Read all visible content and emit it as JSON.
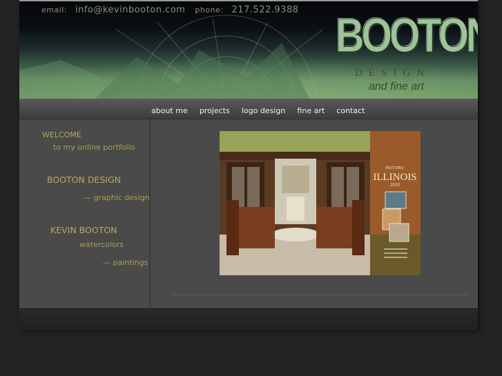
{
  "header": {
    "email_label": "email:",
    "email": "info@kevinbooton.com",
    "phone_label": "phone:",
    "phone": "217.522.9388",
    "logo_word": "BOOTON",
    "logo_design": "DESIGN",
    "logo_tagline": "and fine art"
  },
  "nav": {
    "items": [
      "about me",
      "projects",
      "logo design",
      "fine art",
      "contact"
    ]
  },
  "sidebar": {
    "welcome": "WELCOME",
    "welcome_sub": "to my online portfolio",
    "booton_design": "BOOTON DESIGN",
    "graphic_design": "— graphic design",
    "kevin_booton": "KEVIN BOOTON",
    "watercolors": "watercolors",
    "paintings": "— paintings"
  },
  "feature": {
    "poster_small": "HISTORIC",
    "poster_title": "ILLINOIS",
    "poster_year": "2010"
  },
  "colors": {
    "background": "#232323",
    "panel": "#4a4a4a",
    "accent_text": "#b4a85e",
    "nav_text": "#f0f0f0"
  }
}
